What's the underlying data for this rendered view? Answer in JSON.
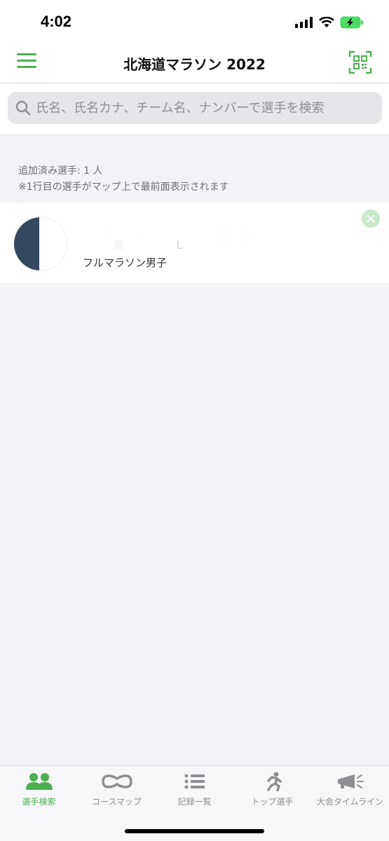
{
  "status": {
    "time": "4:02"
  },
  "header": {
    "title": "北海道マラソン 2022"
  },
  "search": {
    "placeholder": "氏名、氏名カナ、チーム名、ナンバーで選手を検索"
  },
  "info": {
    "added_count": "追加済み選手: 1 人",
    "note": "※1行目の選手がマップ上で最前面表示されます"
  },
  "runner": {
    "name": "",
    "team_fragment_1": "県",
    "team_fragment_2": "L",
    "race": "フルマラソン男子"
  },
  "tabs": [
    {
      "label": "選手検索",
      "icon": "runners-icon",
      "active": true
    },
    {
      "label": "コースマップ",
      "icon": "course-icon",
      "active": false
    },
    {
      "label": "記録一覧",
      "icon": "list-icon",
      "active": false
    },
    {
      "label": "トップ選手",
      "icon": "runner-icon",
      "active": false
    },
    {
      "label": "大会タイムライン",
      "icon": "megaphone-icon",
      "active": false
    }
  ],
  "colors": {
    "accent": "#4caf50",
    "inactive": "#8e8e93"
  }
}
